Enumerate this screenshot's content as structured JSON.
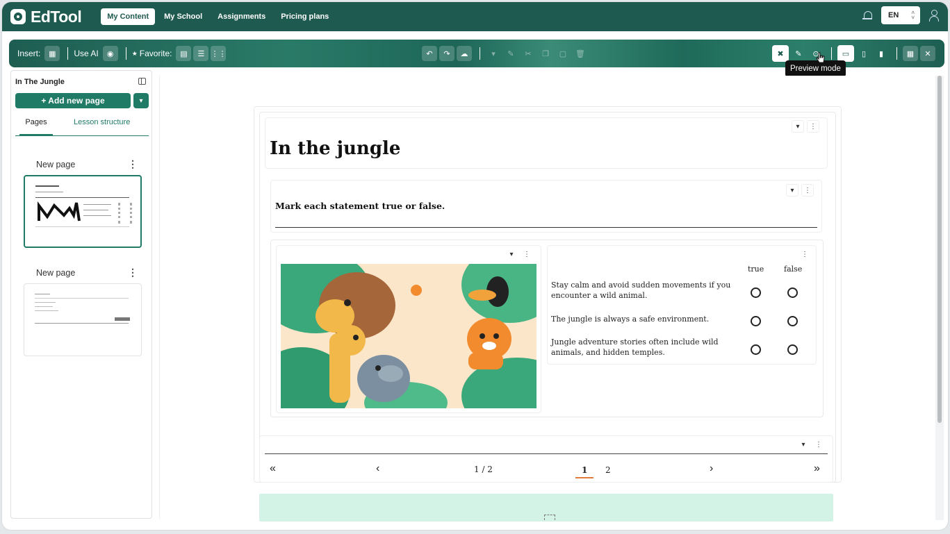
{
  "app": {
    "name": "EdTool"
  },
  "nav": {
    "items": [
      "My Content",
      "My School",
      "Assignments",
      "Pricing plans"
    ],
    "active": "My Content"
  },
  "header": {
    "language": "EN"
  },
  "toolbar": {
    "insert_label": "Insert:",
    "use_ai_label": "Use AI",
    "favorite_label": "Favorite:",
    "tooltip": "Preview mode"
  },
  "sidebar": {
    "lesson_title": "In The Jungle",
    "add_page_label": "+ Add new page",
    "tabs": [
      "Pages",
      "Lesson structure"
    ],
    "active_tab": "Pages",
    "pages": [
      {
        "title": "New page",
        "selected": true
      },
      {
        "title": "New page",
        "selected": false
      }
    ]
  },
  "document": {
    "title": "In the jungle",
    "instruction": "Mark each statement true or false.",
    "columns": {
      "true": "true",
      "false": "false"
    },
    "statements": [
      "Stay calm and avoid sudden movements if you encounter a wild animal.",
      "The jungle is always a safe environment.",
      "Jungle adventure stories often include wild animals, and hidden temples."
    ],
    "pager": {
      "position": "1 / 2",
      "pages": [
        "1",
        "2"
      ],
      "current": "1"
    }
  },
  "colors": {
    "primary": "#1e5a4f",
    "accent": "#1f7a66",
    "preview_block": "#d3f3e6",
    "pager_underline": "#e07b3c"
  }
}
